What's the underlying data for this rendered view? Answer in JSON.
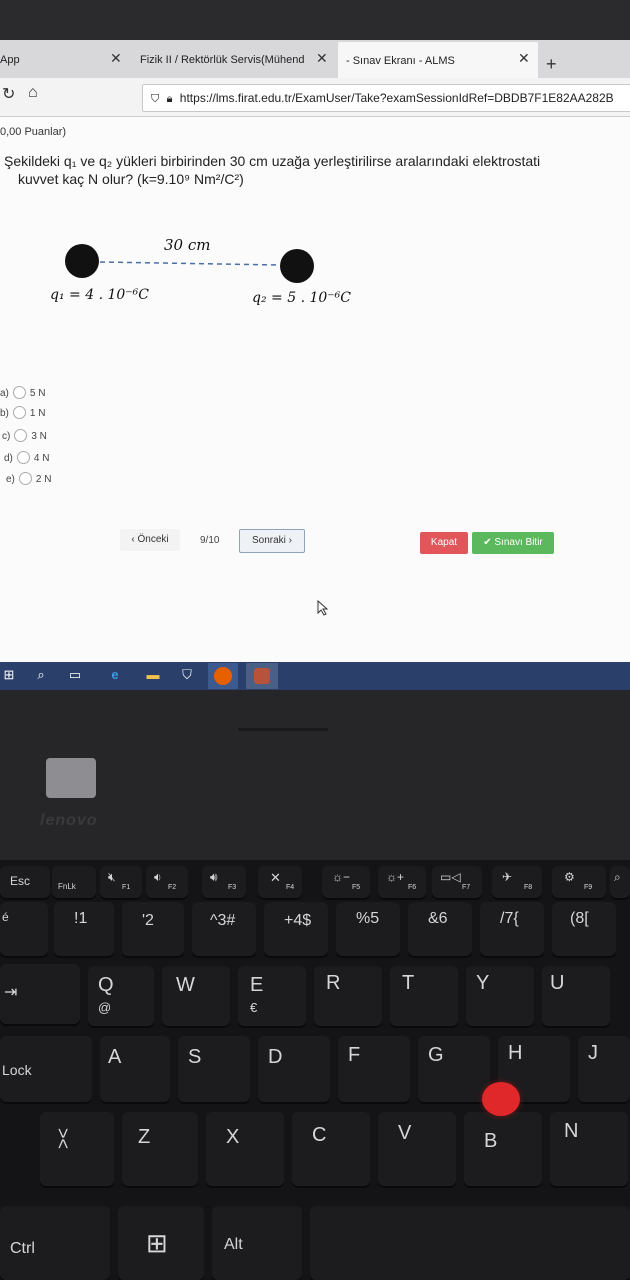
{
  "browser": {
    "tabs": [
      {
        "label": "App",
        "active": false
      },
      {
        "label": "Fizik II / Rektörlük Servis(Mühend",
        "active": false
      },
      {
        "label": "- Sınav Ekranı - ALMS",
        "active": true
      }
    ],
    "new_tab": "+",
    "url": "https://lms.firat.edu.tr/ExamUser/Take?examSessionIdRef=DBDB7F1E82AA282B"
  },
  "question": {
    "points": "0,00 Puanlar)",
    "line1": "Şekildeki q₁ ve q₂ yükleri birbirinden 30 cm uzağa yerleştirilirse aralarındaki elektrostati",
    "line2": "kuvvet kaç N olur? (k=9.10⁹ Nm²/C²)",
    "figure": {
      "distance": "30 cm",
      "q1": "q₁ = 4 . 10⁻⁶C",
      "q2": "q₂ = 5 . 10⁻⁶C"
    },
    "options": [
      {
        "letter": "a)",
        "text": "5 N"
      },
      {
        "letter": "b)",
        "text": "1 N"
      },
      {
        "letter": "c)",
        "text": "3 N"
      },
      {
        "letter": "d)",
        "text": "4 N"
      },
      {
        "letter": "e)",
        "text": "2 N"
      }
    ]
  },
  "nav": {
    "prev": "‹ Önceki",
    "page": "9/10",
    "next": "Sonraki ›",
    "close": "Kapat",
    "finish": "✔ Sınavı Bitir"
  },
  "laptop": {
    "brand": "lenovo",
    "keys": {
      "esc": "Esc",
      "fnlk": "FnLk",
      "lock": "Lock",
      "ctrl": "Ctrl",
      "alt": "Alt",
      "row_num": [
        "!1",
        "'2",
        "^3#",
        "+4$",
        "%5",
        "&6",
        "/7{",
        "(8["
      ],
      "row_q": [
        "Q",
        "W",
        "E",
        "R",
        "T",
        "Y",
        "U"
      ],
      "q_alt": "@",
      "e_alt": "€",
      "row_a": [
        "A",
        "S",
        "D",
        "F",
        "G",
        "H",
        "J"
      ],
      "row_z": [
        "Z",
        "X",
        "C",
        "V",
        "B",
        "N"
      ],
      "fkeys": [
        "F1",
        "F2",
        "F3",
        "F4",
        "F5",
        "F6",
        "F7",
        "F8",
        "F9"
      ]
    }
  },
  "colors": {
    "kapat": "#e0565b",
    "finish": "#5cb85c",
    "taskbar": "#2a3f6a",
    "trackpoint": "#e0282a"
  }
}
